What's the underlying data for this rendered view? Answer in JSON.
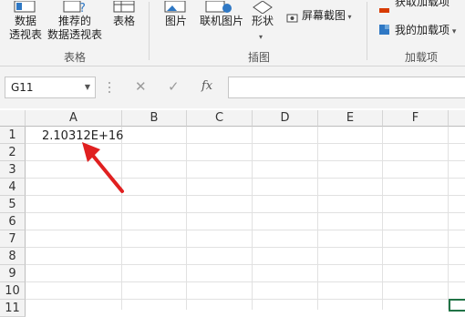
{
  "ribbon": {
    "table_group": {
      "pivot_label": "数据\n透视表",
      "recommended_pivot_label": "推荐的\n数据透视表",
      "table_label": "表格",
      "group_label": "表格"
    },
    "illustrations_group": {
      "picture_label": "图片",
      "online_picture_label": "联机图片",
      "shapes_label": "形状",
      "screenshot_label": "屏幕截图",
      "group_label": "插图"
    },
    "addins_group": {
      "get_addins_label": "获取加载项",
      "my_addins_label": "我的加载项",
      "group_label": "加载项"
    }
  },
  "formula_bar": {
    "name_box": "G11",
    "fx_label": "fx",
    "formula_value": ""
  },
  "sheet": {
    "columns": [
      "A",
      "B",
      "C",
      "D",
      "E",
      "F"
    ],
    "rows": [
      "1",
      "2",
      "3",
      "4",
      "5",
      "6",
      "7",
      "8",
      "9",
      "10",
      "11"
    ],
    "cell_a1": "2.10312E+16"
  },
  "colors": {
    "arrow": "#e02020",
    "ribbon_bg": "#f3f3f3",
    "selection": "#217346"
  }
}
